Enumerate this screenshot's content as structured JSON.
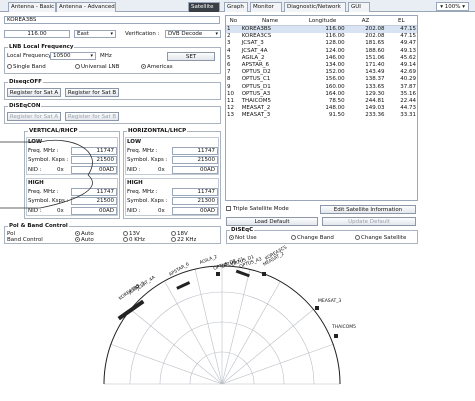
{
  "tabs": [
    "Antenna - Basic Info.",
    "Antenna - Advanced Info.",
    "Satellite",
    "Graph",
    "Monitor",
    "Diagnostic/Network",
    "GUI"
  ],
  "zoom": "100%",
  "satellite_name": "KOREA3BS",
  "longitude_value": "116.00",
  "longitude_dir": "East",
  "verification_label": "Verification :",
  "verification_value": "DVB Decode",
  "lnb": {
    "title": "LNB Local Frequency",
    "freq_label": "Local Frequency :",
    "freq_value": "10500",
    "unit": "MHz",
    "set_label": "SET",
    "options": [
      "Single Band",
      "Universal LNB",
      "Americas"
    ]
  },
  "diseqc_off": {
    "title": "DiseqcOFF",
    "btn_a": "Register for Sat A",
    "btn_b": "Register for Sat B"
  },
  "diseqc_on": {
    "title": "DiSEqCON",
    "btn_a": "Register for Sat A",
    "btn_b": "Register for Sat B"
  },
  "vertical": {
    "title": "VERTICAL/RHCP",
    "low": {
      "title": "LOW",
      "freq_label": "Freq. MHz :",
      "freq": "11747",
      "sym_label": "Symbol. Ksps :",
      "sym": "21500",
      "nid_label": "NID :",
      "nid_x": "0x",
      "nid": "00AD"
    },
    "high": {
      "title": "HIGH",
      "freq_label": "Freq. MHz :",
      "freq": "11747",
      "sym_label": "Symbol. Ksps :",
      "sym": "21500",
      "nid_label": "NID :",
      "nid_x": "0x",
      "nid": "00AD"
    }
  },
  "horizontal": {
    "title": "HORIZONTAL/LHCP",
    "low": {
      "title": "LOW",
      "freq_label": "Freq. MHz :",
      "freq": "11747",
      "sym_label": "Symbol. Ksps :",
      "sym": "21500",
      "nid_label": "NID :",
      "nid_x": "0x",
      "nid": "00AD"
    },
    "high": {
      "title": "HIGH",
      "freq_label": "Freq. MHz :",
      "freq": "11747",
      "sym_label": "Symbol. Ksps :",
      "sym": "21300",
      "nid_label": "NID :",
      "nid_x": "0x",
      "nid": "00AD"
    }
  },
  "pol_band": {
    "title": "Pol & Band Control",
    "pol_label": "Pol",
    "band_label": "Band Control",
    "pol_options": [
      "Auto",
      "13V",
      "18V"
    ],
    "band_options": [
      "Auto",
      "0 KHz",
      "22 KHz"
    ]
  },
  "table": {
    "headers": [
      "No",
      "Name",
      "Longitude",
      "AZ",
      "EL"
    ],
    "rows": [
      [
        "1",
        "KOREA3BS",
        "116.00",
        "202.08",
        "47.15"
      ],
      [
        "2",
        "KOREA3CS",
        "116.00",
        "202.08",
        "47.15"
      ],
      [
        "3",
        "JCSAT_3",
        "128.00",
        "181.65",
        "49.47"
      ],
      [
        "4",
        "JCSAT_4A",
        "124.00",
        "188.60",
        "49.13"
      ],
      [
        "5",
        "AGILA_2",
        "146.00",
        "151.06",
        "45.62"
      ],
      [
        "6",
        "APSTAR_6",
        "134.00",
        "171.40",
        "49.14"
      ],
      [
        "7",
        "OPTUS_D2",
        "152.00",
        "143.49",
        "42.69"
      ],
      [
        "8",
        "OPTUS_C1",
        "156.00",
        "138.37",
        "40.29"
      ],
      [
        "9",
        "OPTUS_D1",
        "160.00",
        "133.65",
        "37.87"
      ],
      [
        "10",
        "OPTUS_A3",
        "164.00",
        "129.30",
        "35.16"
      ],
      [
        "11",
        "THAICOM5",
        "78.50",
        "244.81",
        "22.44"
      ],
      [
        "12",
        "MEASAT_2",
        "148.00",
        "149.03",
        "44.73"
      ],
      [
        "13",
        "MEASAT_3",
        "91.50",
        "233.36",
        "33.31"
      ]
    ]
  },
  "triple_mode_label": "Triple Satellite Mode",
  "edit_info_label": "Edit Satellite Information",
  "load_default_label": "Load Default",
  "update_default_label": "Update Default",
  "diseqc_sel": {
    "title": "DiSEqC",
    "options": [
      "Not Use",
      "Change Band",
      "Change Satellite"
    ]
  },
  "arc_labels": [
    {
      "text": "KOREA3BS"
    },
    {
      "text": "JCSAT_3"
    },
    {
      "text": "JCSAT_4A"
    },
    {
      "text": "APSTAR_6"
    },
    {
      "text": "AGILA_2"
    },
    {
      "text": "OPTUS_D2"
    },
    {
      "text": "OPTUS_C1"
    },
    {
      "text": "OPTUS_D1"
    },
    {
      "text": "OPTUS_A3"
    },
    {
      "text": "MEASAT_2"
    },
    {
      "text": "MEASAT_3"
    },
    {
      "text": "THAICOM5"
    },
    {
      "text": "KOREA3CS"
    }
  ],
  "colors": {
    "active_tab": "#3a3f45",
    "selected_row": "#d8e4f3",
    "border": "#9aa7b8"
  }
}
